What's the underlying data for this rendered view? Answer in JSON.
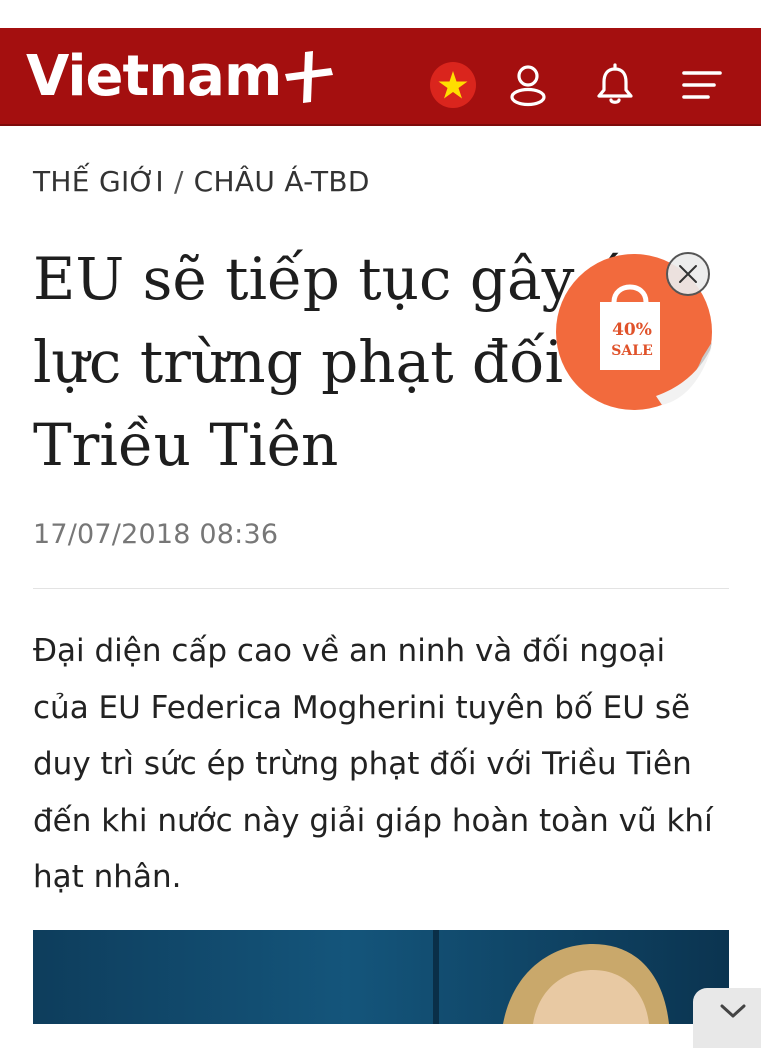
{
  "header": {
    "logo_text": "Vietnam",
    "colors": {
      "brand": "#a40f0f",
      "flag_red": "#da251d",
      "flag_star": "#ffde00"
    },
    "icons": [
      "vietnam-flag-icon",
      "user-icon",
      "bell-icon",
      "menu-icon"
    ]
  },
  "breadcrumb": {
    "section": "THẾ GIỚI",
    "separator": "/",
    "subsection": "CHÂU Á-TBD"
  },
  "article": {
    "title": "EU sẽ tiếp tục gây áp lực trừng phạt đối với Triều Tiên",
    "date": "17/07/2018 08:36",
    "lead": "Đại diện cấp cao về an ninh và đối ngoại của EU Federica Mogherini tuyên bố EU sẽ duy trì sức ép trừng phạt đối với Triều Tiên đến khi nước này giải giáp hoàn toàn vũ khí hạt nhân."
  },
  "promo": {
    "discount": "40%",
    "label": "SALE",
    "colors": {
      "circle": "#f26a3d",
      "bag": "#ffffff",
      "text": "#e0522a"
    }
  }
}
